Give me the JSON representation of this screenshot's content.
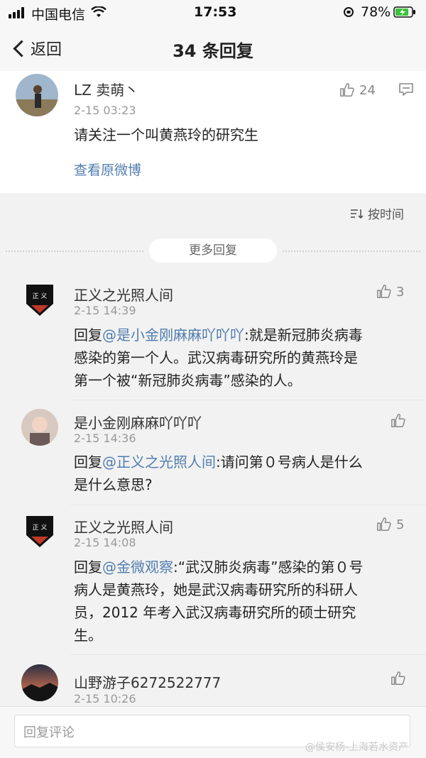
{
  "status_bar": {
    "carrier": "中国电信",
    "time": "17:53",
    "battery": "78%"
  },
  "nav": {
    "back_label": "返回",
    "title": "34 条回复"
  },
  "post": {
    "author": "LZ 卖萌丶",
    "time": "2-15 03:23",
    "text": "请关注一个叫黄燕玲的研究生",
    "likes": "24",
    "view_original": "查看原微博"
  },
  "sort_label": "按时间",
  "more_replies": "更多回复",
  "comments": [
    {
      "author": "正义之光照人间",
      "time": "2-15 14:39",
      "likes": "3",
      "reply_prefix": "回复",
      "mention": "@是小金刚麻麻吖吖吖",
      "text_l1": ":就是新冠肺炎病毒",
      "text_l2": "感染的第一个人。武汉病毒研究所的黄燕玲是",
      "text_l3": "第一个被“新冠肺炎病毒”感染的人。"
    },
    {
      "author": "是小金刚麻麻吖吖吖",
      "time": "2-15 14:36",
      "likes": "",
      "reply_prefix": "回复",
      "mention": "@正义之光照人间",
      "text_l1": ":请问第０号病人是什么",
      "text_l2": "是什么意思?"
    },
    {
      "author": "正义之光照人间",
      "time": "2-15 14:08",
      "likes": "5",
      "reply_prefix": "回复",
      "mention": "@金微观察",
      "text_l1": ":“武汉肺炎病毒”感染的第０号",
      "text_l2": "病人是黄燕玲，她是武汉病毒研究所的科研人",
      "text_l3": "员，2012 年考入武汉病毒研究所的硕士研究",
      "text_l4": "生。"
    },
    {
      "author": "山野游子6272522777",
      "time": "2-15 10:26",
      "likes": ""
    }
  ],
  "footer": {
    "input_placeholder": "回复评论",
    "watermark": "@侯安杨-上海若水资产"
  },
  "colors": {
    "link": "#507daf",
    "time": "#999999",
    "bg": "#f2f2f2"
  }
}
